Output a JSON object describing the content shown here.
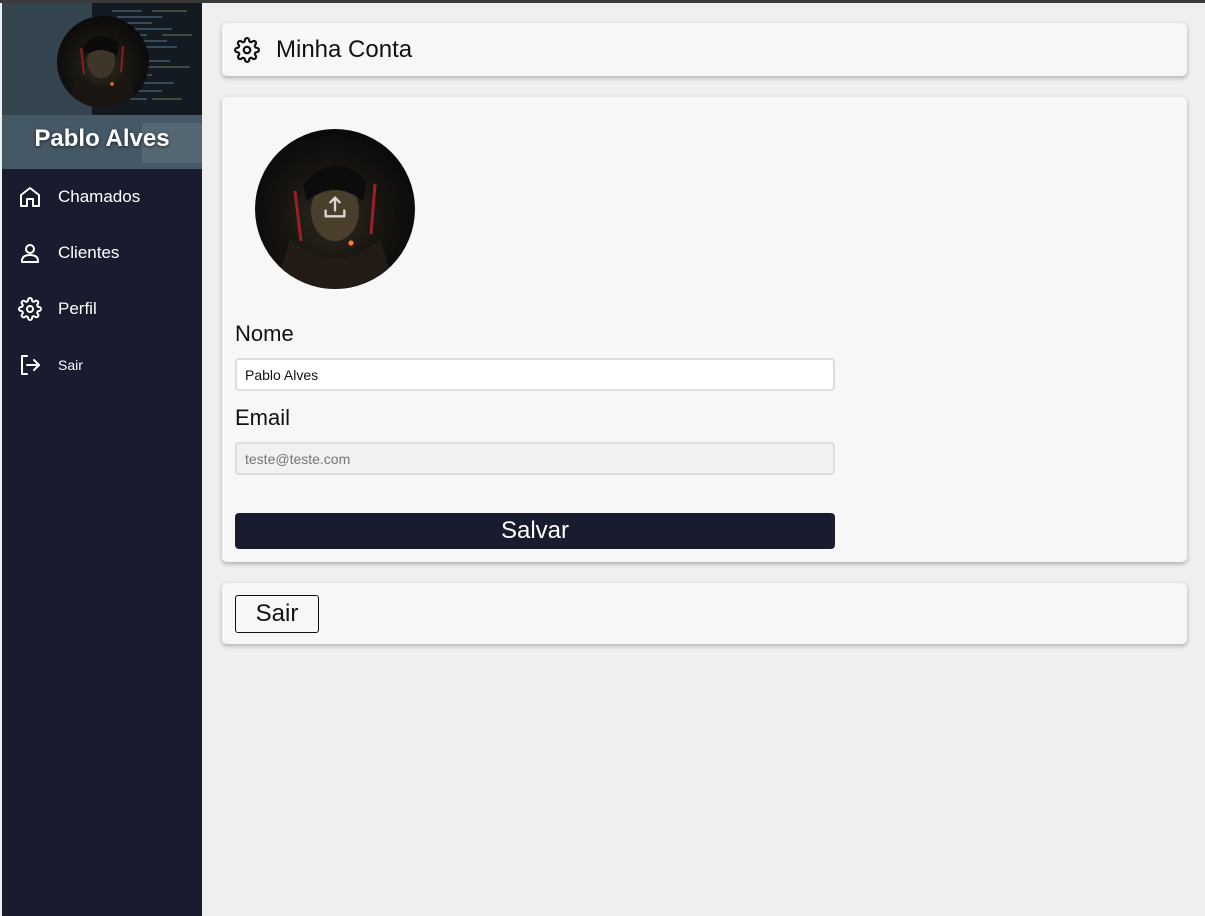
{
  "sidebar": {
    "user_name": "Pablo Alves",
    "items": [
      {
        "label": "Chamados",
        "icon": "home-icon"
      },
      {
        "label": "Clientes",
        "icon": "user-icon"
      },
      {
        "label": "Perfil",
        "icon": "gear-icon"
      },
      {
        "label": "Sair",
        "icon": "logout-icon"
      }
    ]
  },
  "header": {
    "title": "Minha Conta",
    "icon": "gear-icon"
  },
  "form": {
    "avatar_icon": "upload-icon",
    "name_label": "Nome",
    "name_value": "Pablo Alves",
    "email_label": "Email",
    "email_placeholder": "teste@teste.com",
    "save_label": "Salvar"
  },
  "logout": {
    "label": "Sair"
  },
  "colors": {
    "sidebar_bg": "#181c2e",
    "page_bg": "#efefef",
    "card_bg": "#f7f7f7",
    "primary_button": "#181c2e"
  }
}
